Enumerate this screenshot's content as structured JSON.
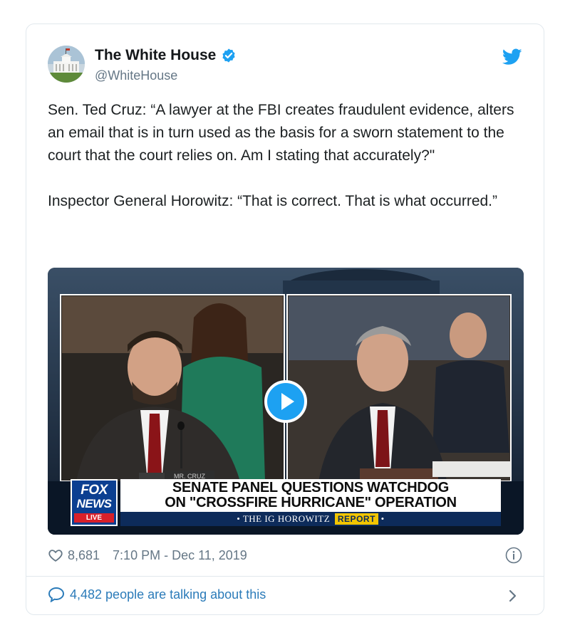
{
  "tweet": {
    "display_name": "The White House",
    "handle": "@WhiteHouse",
    "paragraphs": [
      "Sen. Ted Cruz: “A lawyer at the FBI creates fraudulent evidence, alters an email that is in turn used as the basis for a sworn statement to the court that the court relies on. Am I stating that accurately?\"",
      "Inspector General Horowitz: “That is correct. That is what occurred.”"
    ],
    "likes": "8,681",
    "timestamp": "7:10 PM - Dec 11, 2019",
    "talking": "4,482 people are talking about this"
  },
  "video": {
    "network_line1": "FOX",
    "network_line2": "NEWS",
    "live_badge": "LIVE",
    "headline_line1": "SENATE PANEL QUESTIONS WATCHDOG",
    "headline_line2": "ON \"CROSSFIRE HURRICANE\" OPERATION",
    "subline_prefix": "• THE IG HOROWITZ",
    "subline_badge": "REPORT",
    "subline_suffix": "•",
    "nameplate": "MR. CRUZ"
  },
  "colors": {
    "twitter_blue": "#1da1f2",
    "link_blue": "#2b7bb9",
    "secondary_text": "#657786",
    "border": "#e1e8ed"
  },
  "icons": [
    "verified-badge-icon",
    "twitter-bird-icon",
    "play-icon",
    "heart-icon",
    "info-icon",
    "comment-bubble-icon",
    "chevron-right-icon"
  ]
}
